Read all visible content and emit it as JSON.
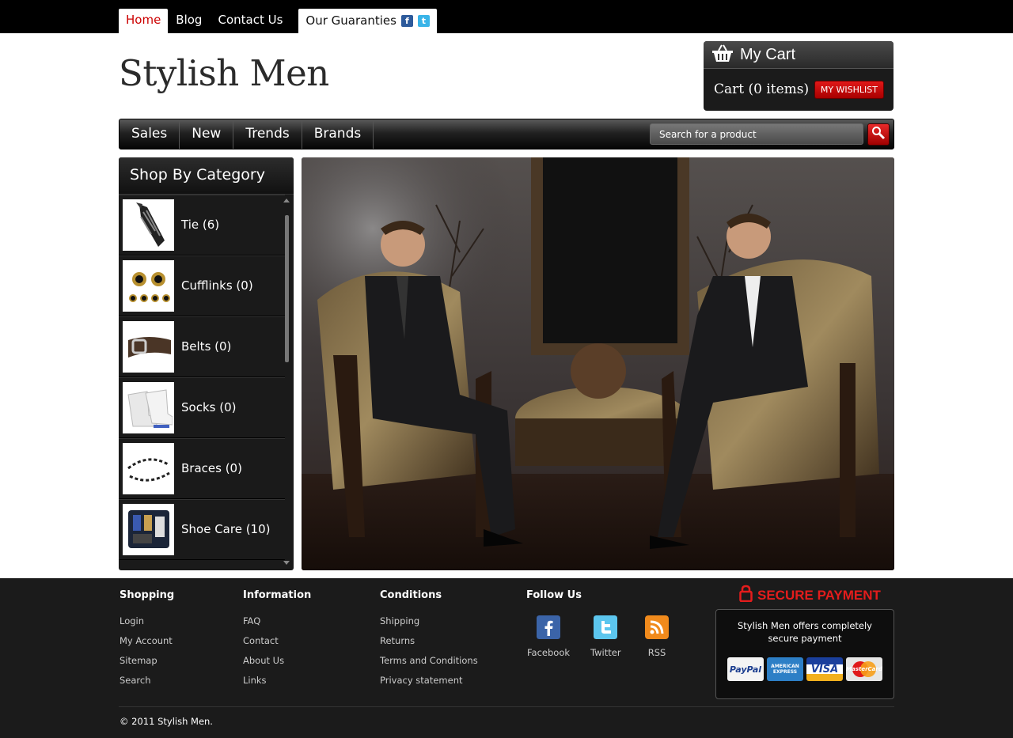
{
  "top_nav": {
    "items": [
      {
        "label": "Home"
      },
      {
        "label": "Blog"
      },
      {
        "label": "Contact Us"
      }
    ],
    "guaranties_label": "Our Guaranties"
  },
  "header": {
    "logo": "Stylish Men"
  },
  "cart": {
    "title": "My Cart",
    "count_text": "Cart (0 items)",
    "wishlist_label": "MY WISHLIST"
  },
  "main_nav": {
    "items": [
      {
        "label": "Sales"
      },
      {
        "label": "New"
      },
      {
        "label": "Trends"
      },
      {
        "label": "Brands"
      }
    ],
    "search_placeholder": "Search for a product"
  },
  "sidebar": {
    "title": "Shop By Category",
    "categories": [
      {
        "label": "Tie (6)"
      },
      {
        "label": "Cufflinks (0)"
      },
      {
        "label": "Belts (0)"
      },
      {
        "label": "Socks (0)"
      },
      {
        "label": "Braces (0)"
      },
      {
        "label": "Shoe Care (10)"
      }
    ]
  },
  "footer": {
    "shopping": {
      "title": "Shopping",
      "links": [
        "Login",
        "My Account",
        "Sitemap",
        "Search"
      ]
    },
    "information": {
      "title": "Information",
      "links": [
        "FAQ",
        "Contact",
        "About Us",
        "Links"
      ]
    },
    "conditions": {
      "title": "Conditions",
      "links": [
        "Shipping",
        "Returns",
        "Terms and Conditions",
        "Privacy statement"
      ]
    },
    "follow": {
      "title": "Follow Us",
      "items": [
        "Facebook",
        "Twitter",
        "RSS"
      ]
    },
    "secure": {
      "title": "SECURE PAYMENT",
      "text": "Stylish Men offers completely secure payment",
      "cards": [
        "PayPal",
        "AMERICAN EXPRESS",
        "VISA",
        "MasterCard"
      ]
    },
    "copyright": "© 2011 Stylish Men."
  },
  "colors": {
    "accent_red": "#cc0000",
    "footer_bg": "#1b1b1b",
    "nav_bg": "#000000"
  }
}
